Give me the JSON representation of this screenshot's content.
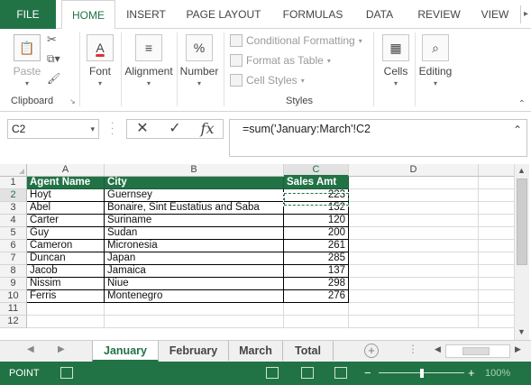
{
  "ribbon_tabs": [
    "FILE",
    "HOME",
    "INSERT",
    "PAGE LAYOUT",
    "FORMULAS",
    "DATA",
    "REVIEW",
    "VIEW"
  ],
  "ribbon": {
    "clipboard": {
      "paste": "Paste",
      "label": "Clipboard"
    },
    "font": "Font",
    "alignment": "Alignment",
    "number": "Number",
    "styles": {
      "conditional": "Conditional Formatting",
      "format_table": "Format as Table",
      "cell_styles": "Cell Styles",
      "label": "Styles"
    },
    "cells": "Cells",
    "editing": "Editing"
  },
  "formula_bar": {
    "name_box": "C2",
    "cancel": "✕",
    "enter": "✓",
    "fx": "fx",
    "formula": "=sum('January:March'!C2"
  },
  "grid": {
    "columns": [
      "A",
      "B",
      "C",
      "D"
    ],
    "rows": [
      "1",
      "2",
      "3",
      "4",
      "5",
      "6",
      "7",
      "8",
      "9",
      "10",
      "11",
      "12"
    ],
    "header": [
      "Agent Name",
      "City",
      "Sales Amt"
    ],
    "data": [
      [
        "Hoyt",
        "Guernsey",
        "223"
      ],
      [
        "Abel",
        "Bonaire, Sint Eustatius and Saba",
        "152"
      ],
      [
        "Carter",
        "Suriname",
        "120"
      ],
      [
        "Guy",
        "Sudan",
        "200"
      ],
      [
        "Cameron",
        "Micronesia",
        "261"
      ],
      [
        "Duncan",
        "Japan",
        "285"
      ],
      [
        "Jacob",
        "Jamaica",
        "137"
      ],
      [
        "Nissim",
        "Niue",
        "298"
      ],
      [
        "Ferris",
        "Montenegro",
        "276"
      ]
    ]
  },
  "sheets": [
    "January",
    "February",
    "March",
    "Total"
  ],
  "status": {
    "mode": "POINT",
    "zoom": "100%"
  },
  "colors": {
    "accent": "#217346"
  }
}
